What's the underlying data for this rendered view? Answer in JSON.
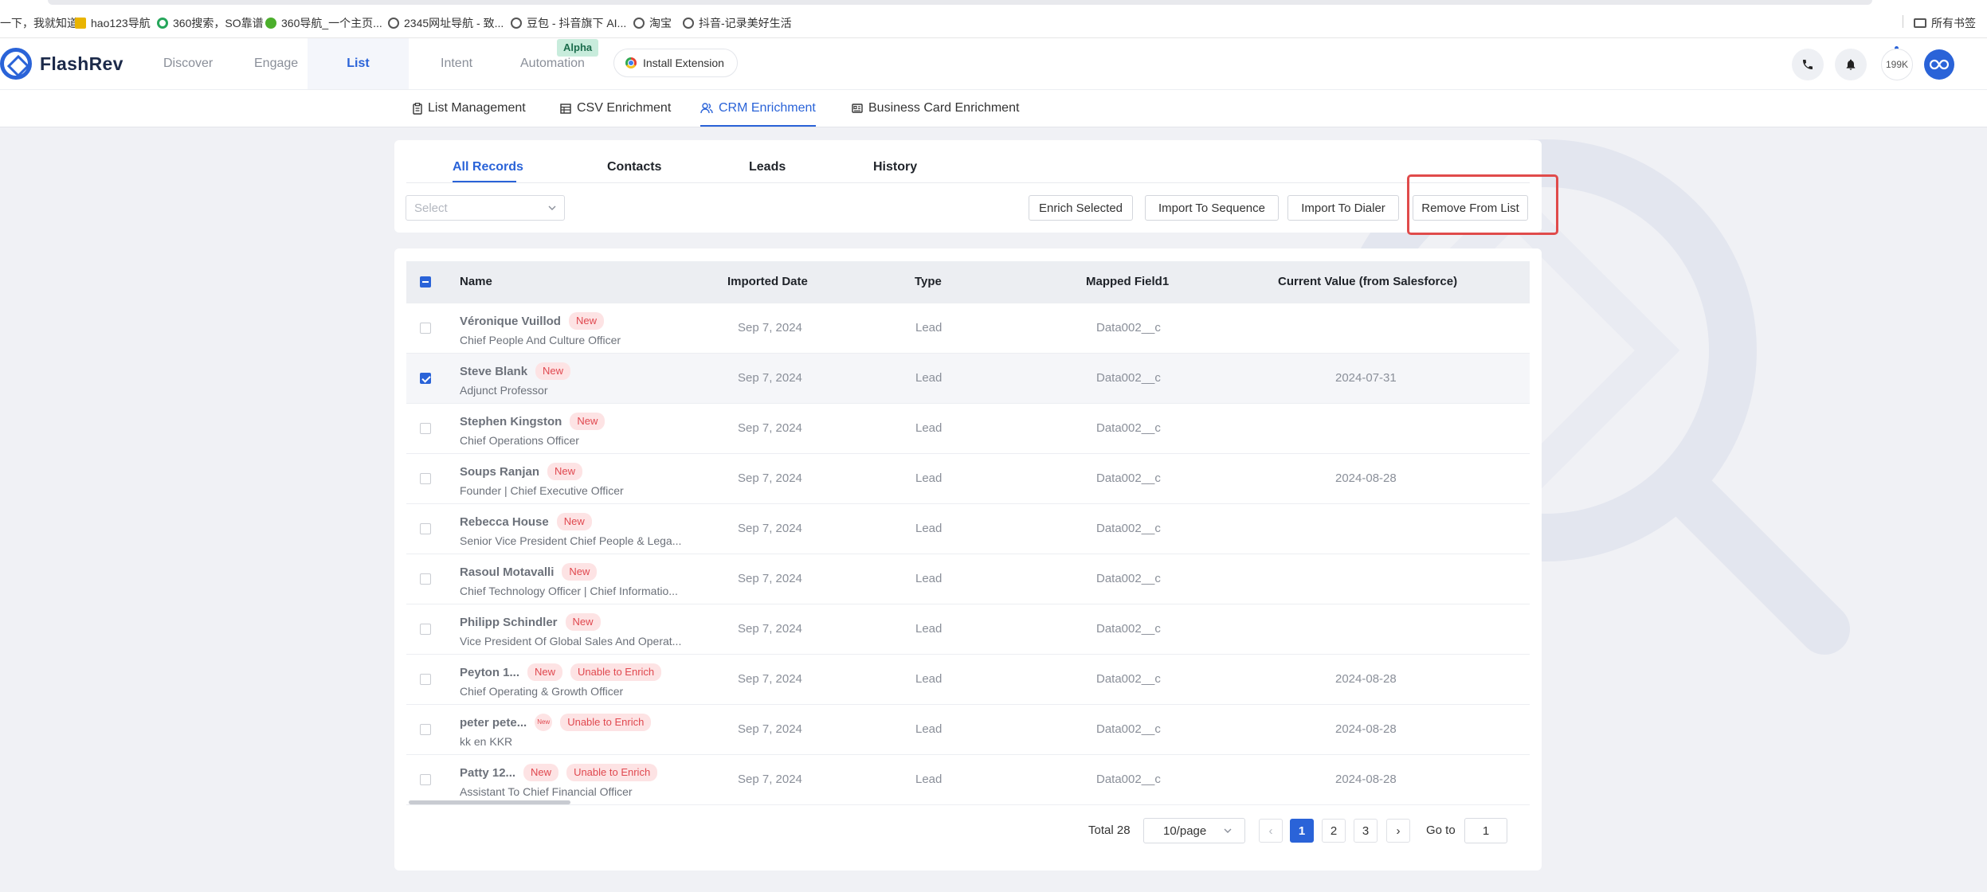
{
  "bookmarks": {
    "items": [
      "一下，我就知道",
      "hao123导航",
      "360搜索，SO靠谱",
      "360导航_一个主页...",
      "2345网址导航 - 致...",
      "豆包 - 抖音旗下 AI...",
      "淘宝",
      "抖音-记录美好生活"
    ],
    "all_bookmarks": "所有书签"
  },
  "header": {
    "logo": "FlashRev",
    "nav": [
      "Discover",
      "Engage",
      "List",
      "Intent",
      "Automation"
    ],
    "active_nav": "List",
    "alpha_badge": "Alpha",
    "install_extension": "Install Extension",
    "credits": "199K"
  },
  "subtabs": [
    "List Management",
    "CSV Enrichment",
    "CRM Enrichment",
    "Business Card Enrichment"
  ],
  "active_subtab": "CRM Enrichment",
  "records": {
    "tabs": [
      "All Records",
      "Contacts",
      "Leads",
      "History"
    ],
    "active_tab": "All Records",
    "select_placeholder": "Select",
    "actions": [
      "Enrich Selected",
      "Import To Sequence",
      "Import To Dialer",
      "Remove From List"
    ]
  },
  "table": {
    "columns": [
      "Name",
      "Imported Date",
      "Type",
      "Mapped Field1",
      "Current Value (from Salesforce)"
    ],
    "rows": [
      {
        "name": "Véronique Vuillod",
        "badges": [
          "New"
        ],
        "title": "Chief People And Culture Officer",
        "date": "Sep 7, 2024",
        "type": "Lead",
        "field": "Data002__c",
        "value": "",
        "checked": false
      },
      {
        "name": "Steve Blank",
        "badges": [
          "New"
        ],
        "title": "Adjunct Professor",
        "date": "Sep 7, 2024",
        "type": "Lead",
        "field": "Data002__c",
        "value": "2024-07-31",
        "checked": true
      },
      {
        "name": "Stephen Kingston",
        "badges": [
          "New"
        ],
        "title": "Chief Operations Officer",
        "date": "Sep 7, 2024",
        "type": "Lead",
        "field": "Data002__c",
        "value": "",
        "checked": false
      },
      {
        "name": "Soups Ranjan",
        "badges": [
          "New"
        ],
        "title": "Founder | Chief Executive Officer",
        "date": "Sep 7, 2024",
        "type": "Lead",
        "field": "Data002__c",
        "value": "2024-08-28",
        "checked": false
      },
      {
        "name": "Rebecca House",
        "badges": [
          "New"
        ],
        "title": "Senior Vice President Chief People & Lega...",
        "date": "Sep 7, 2024",
        "type": "Lead",
        "field": "Data002__c",
        "value": "",
        "checked": false
      },
      {
        "name": "Rasoul Motavalli",
        "badges": [
          "New"
        ],
        "title": "Chief Technology Officer | Chief Informatio...",
        "date": "Sep 7, 2024",
        "type": "Lead",
        "field": "Data002__c",
        "value": "",
        "checked": false
      },
      {
        "name": "Philipp Schindler",
        "badges": [
          "New"
        ],
        "title": "Vice President Of Global Sales And Operat...",
        "date": "Sep 7, 2024",
        "type": "Lead",
        "field": "Data002__c",
        "value": "",
        "checked": false
      },
      {
        "name": "Peyton 1...",
        "badges": [
          "New",
          "Unable to Enrich"
        ],
        "title": "Chief Operating & Growth Officer",
        "date": "Sep 7, 2024",
        "type": "Lead",
        "field": "Data002__c",
        "value": "2024-08-28",
        "checked": false
      },
      {
        "name": "peter pete...",
        "badges": [
          "New",
          "Unable to Enrich"
        ],
        "title": "kk en KKR",
        "date": "Sep 7, 2024",
        "type": "Lead",
        "field": "Data002__c",
        "value": "2024-08-28",
        "checked": false
      },
      {
        "name": "Patty 12...",
        "badges": [
          "New",
          "Unable to Enrich"
        ],
        "title": "Assistant To Chief Financial Officer",
        "date": "Sep 7, 2024",
        "type": "Lead",
        "field": "Data002__c",
        "value": "2024-08-28",
        "checked": false
      }
    ]
  },
  "pagination": {
    "total": "Total 28",
    "per_page": "10/page",
    "pages": [
      "1",
      "2",
      "3"
    ],
    "current": "1",
    "goto_label": "Go to",
    "goto_value": "1"
  },
  "colors": {
    "accent": "#2a63d8",
    "danger": "#e04b4b",
    "badge_bg": "#fde3e4"
  }
}
